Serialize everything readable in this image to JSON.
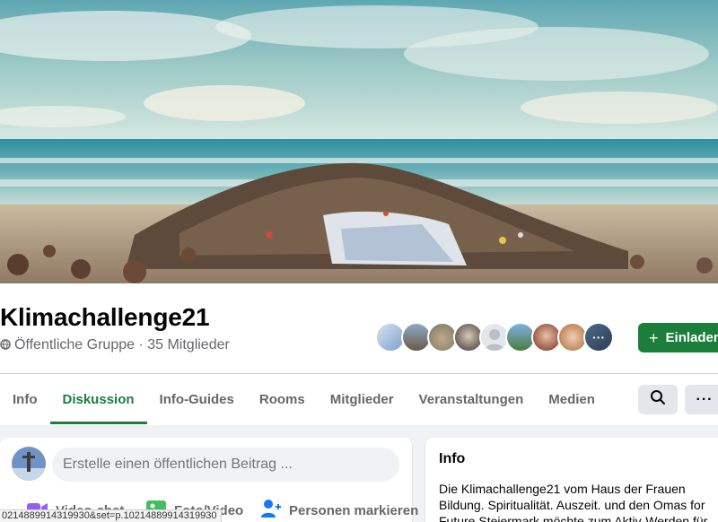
{
  "group": {
    "name": "Klimachallenge21",
    "meta": "Öffentliche Gruppe · 35 Mitglieder",
    "invite_label": "Einladen",
    "members_more": "···"
  },
  "tabs": [
    {
      "label": "Info",
      "active": false
    },
    {
      "label": "Diskussion",
      "active": true
    },
    {
      "label": "Info-Guides",
      "active": false
    },
    {
      "label": "Rooms",
      "active": false
    },
    {
      "label": "Mitglieder",
      "active": false
    },
    {
      "label": "Veranstaltungen",
      "active": false
    },
    {
      "label": "Medien",
      "active": false
    }
  ],
  "toolbar": {
    "more_label": "···"
  },
  "composer": {
    "placeholder": "Erstelle einen öffentlichen Beitrag ...",
    "actions": [
      {
        "label": "Video-chat",
        "icon": "video-camera-icon",
        "color": "#9360f7"
      },
      {
        "label": "Foto/Video",
        "icon": "photo-icon",
        "color": "#45bd62"
      },
      {
        "label": "Personen markieren",
        "icon": "tag-people-icon",
        "color": "#1877f2"
      }
    ]
  },
  "info": {
    "title": "Info",
    "description": "Die Klimachallenge21 vom Haus der Frauen Bildung. Spiritualität. Auszeit. und den Omas for Future Steiermark möchte zum Aktiv-Werden für"
  },
  "statusbar": {
    "url": "0214889914319930&set=p.10214889914319930"
  },
  "colors": {
    "accent": "#1b7f3b",
    "muted": "#65676b",
    "page_bg": "#f0f2f5"
  }
}
